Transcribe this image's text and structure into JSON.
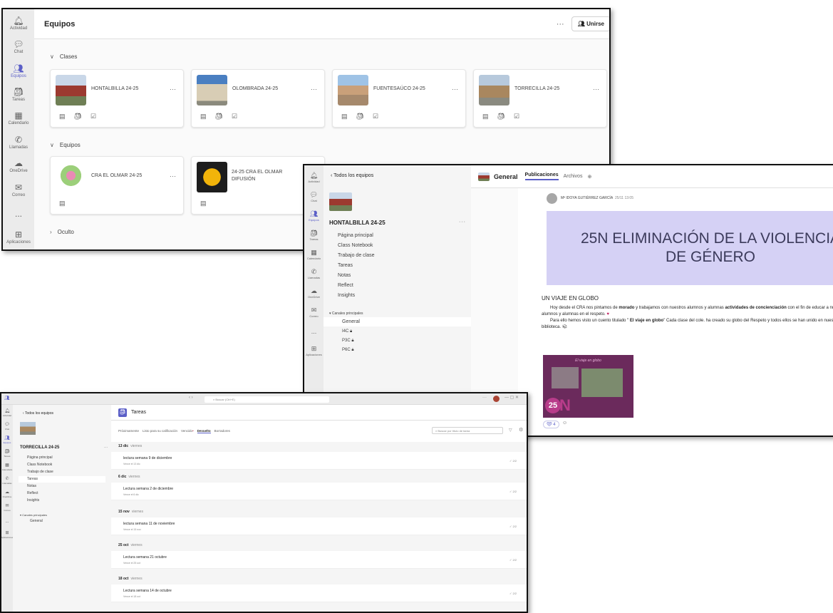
{
  "w1": {
    "rail": [
      {
        "icon": "bell-icon",
        "label": "Actividad"
      },
      {
        "icon": "chat-icon",
        "label": "Chat"
      },
      {
        "icon": "teams-icon",
        "label": "Equipos"
      },
      {
        "icon": "assignments-icon",
        "label": "Tareas"
      },
      {
        "icon": "calendar-icon",
        "label": "Calendario"
      },
      {
        "icon": "phone-icon",
        "label": "Llamadas"
      },
      {
        "icon": "cloud-icon",
        "label": "OneDrive"
      },
      {
        "icon": "mail-icon",
        "label": "Correo"
      },
      {
        "icon": "more-icon",
        "label": "..."
      },
      {
        "icon": "apps-icon",
        "label": "Aplicaciones"
      }
    ],
    "title": "Equipos",
    "more": "···",
    "join": "Unirse",
    "sec_clases": "Clases",
    "sec_equipos": "Equipos",
    "sec_oculto": "Oculto",
    "classes": [
      "HONTALBILLA 24-25",
      "OLOMBRADA 24-25",
      "FUENTESAÚCO 24-25",
      "TORRECILLA 24-25"
    ],
    "teams": [
      "CRA EL OLMAR 24-25",
      "24-25 CRA EL OLMAR DIFUSIÓN"
    ]
  },
  "w2": {
    "rail": [
      "Actividad",
      "Chat",
      "Equipos",
      "Tareas",
      "Calendario",
      "Llamadas",
      "OneDrive",
      "Correo",
      "...",
      "Aplicaciones"
    ],
    "back": "Todos los equipos",
    "team": "HONTALBILLA 24-25",
    "nav": [
      "Página principal",
      "Class Notebook",
      "Trabajo de clase",
      "Tareas",
      "Notas",
      "Reflect",
      "Insights"
    ],
    "channels_hdr": "Canales principales",
    "channels": [
      "General",
      "I4C",
      "P3C",
      "P6C"
    ],
    "channel_title": "General",
    "tabs": [
      "Publicaciones",
      "Archivos"
    ],
    "author": "Mª IDOYA GUTIÉRREZ GARCÍA",
    "time": "25/11 13:05",
    "banner": "25N ELIMINACIÓN DE LA VIOLENCIA DE GÉNERO",
    "post_title": "UN VIAJE EN GLOBO",
    "post_p1_a": "Hoy desde el CRA nos pintamos de ",
    "post_p1_b": "morado",
    "post_p1_c": " y trabajamos con nuestros alumnos y alumnas  ",
    "post_p1_d": "actividades de concienciación",
    "post_p1_e": " con el fin de educar a nuestros alumnos y alumnas en el respeto.",
    "post_p2_a": "Para ello hemos visto un cuento titulado \"",
    "post_p2_b": " El viaje en globo",
    "post_p2_c": "\" Cada clase del cole. ha creado su globo del Respeto y todos ellos se han unido en nuestra biblioteca.",
    "img_caption": "El viaje en globo",
    "img_num": "25",
    "reactions": "4"
  },
  "w3": {
    "search": "Buscar (Ctrl+E)",
    "back": "Todos los equipos",
    "team": "TORRECILLA 24-25",
    "nav": [
      "Página principal",
      "Class Notebook",
      "Trabajo de clase",
      "Tareas",
      "Notas",
      "Reflect",
      "Insights"
    ],
    "channels_hdr": "Canales principales",
    "channels": [
      "General"
    ],
    "app_title": "Tareas",
    "tabs": [
      "Próximamente",
      "Listo para su calificación",
      "Vencido",
      "Devuelto",
      "Borradores"
    ],
    "filter": "Buscar por título de tarea",
    "groups": [
      {
        "date": "13 dic",
        "day": "viernes",
        "title": "lectura semana 9 de diciembre",
        "due": "Vence el 13 dic",
        "score": "2/2"
      },
      {
        "date": "6 dic",
        "day": "viernes",
        "title": "Lectura semana 2 de diciembre",
        "due": "Vence el 6 dic",
        "score": "2/2"
      },
      {
        "date": "15 nov",
        "day": "viernes",
        "title": "lectura semana 11 de noviembre",
        "due": "Vence el 15 nov",
        "score": "2/2"
      },
      {
        "date": "25 oct",
        "day": "viernes",
        "title": "Lectura semana 21 octubre",
        "due": "Vence el 25 oct",
        "score": "2/2"
      },
      {
        "date": "18 oct",
        "day": "viernes",
        "title": "Lectura semana 14 de octubre",
        "due": "Vence el 18 oct",
        "score": "2/2"
      }
    ]
  },
  "colors": {
    "accent": "#5b5fc7",
    "banner": "#d5d1f5",
    "purple": "#6b2a5c"
  }
}
